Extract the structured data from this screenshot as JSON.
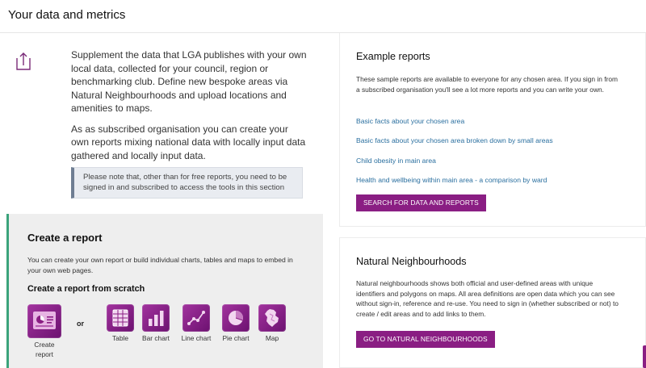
{
  "page": {
    "title": "Your data and metrics"
  },
  "intro": {
    "paragraph1": "Supplement the data that LGA publishes with your own local data, collected for your council, region or benchmarking club. Define new bespoke areas via Natural Neighbourhoods and upload locations and amenities to maps.",
    "paragraph2": "As as subscribed organisation you can create your own reports mixing national data with locally input data gathered and locally input data.",
    "notice": "Please note that, other than for free reports, you need to be signed in and subscribed to access the tools in this section",
    "icon": "upload-icon"
  },
  "create": {
    "title": "Create a report",
    "description": "You can create your own report or build individual charts, tables and maps to embed in your own web pages.",
    "scratch_title": "Create a report from scratch",
    "or_label": "or",
    "tools": [
      {
        "label": "Create report",
        "icon": "report-icon"
      },
      {
        "label": "Table",
        "icon": "table-icon"
      },
      {
        "label": "Bar chart",
        "icon": "bar-chart-icon"
      },
      {
        "label": "Line chart",
        "icon": "line-chart-icon"
      },
      {
        "label": "Pie chart",
        "icon": "pie-chart-icon"
      },
      {
        "label": "Map",
        "icon": "map-icon"
      }
    ],
    "accent_color": "#3ba37b"
  },
  "examples": {
    "title": "Example reports",
    "body": "These sample reports are available to everyone for any chosen area. If you sign in from a subscribed organisation you'll see a lot more reports and you can write your own.",
    "links": [
      "Basic facts about your chosen area",
      "Basic facts about your chosen area broken down by small areas",
      "Child obesity in main area",
      "Health and wellbeing within main area - a comparison by ward"
    ],
    "button": "SEARCH FOR DATA AND REPORTS"
  },
  "natural": {
    "title": "Natural Neighbourhoods",
    "body": "Natural neighbourhoods shows both official and user-defined areas with unique identifiers and polygons on maps. All area definitions are open data which you can see without sign-in, reference and re-use. You need to sign in (whether subscribed or not) to create / edit areas and to add links to them.",
    "button": "GO TO NATURAL NEIGHBOURHOODS"
  },
  "colors": {
    "brand_purple": "#8a1e83",
    "link_blue": "#2a6f9f"
  }
}
